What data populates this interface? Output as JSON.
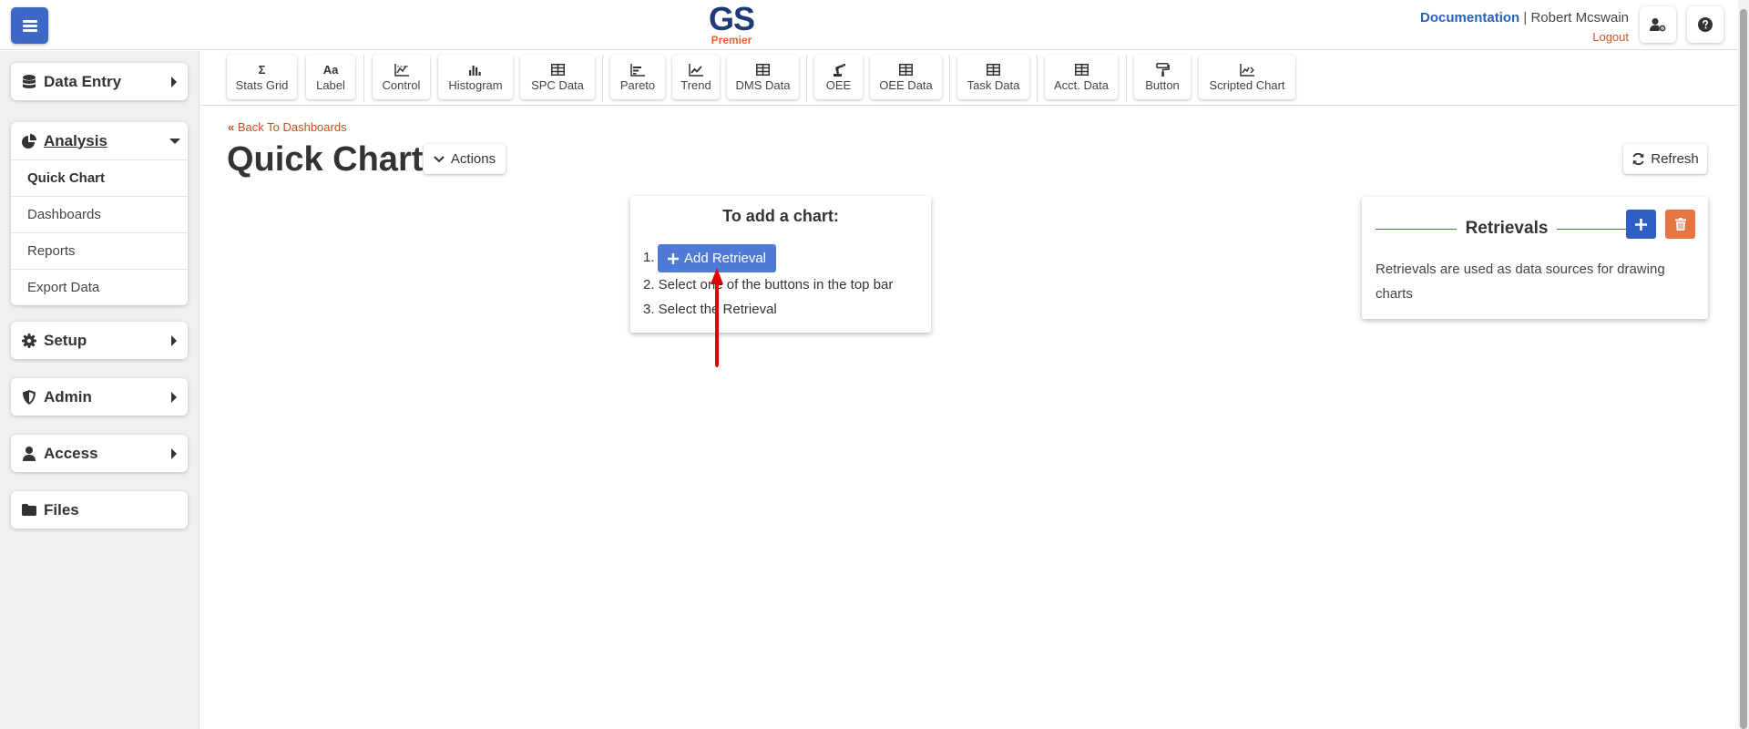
{
  "header": {
    "logo_main": "GS",
    "logo_sub": "Premier",
    "documentation": "Documentation",
    "separator": "|",
    "user_name": "Robert Mcswain",
    "logout": "Logout"
  },
  "sidebar": {
    "data_entry": "Data Entry",
    "analysis": "Analysis",
    "analysis_items": [
      "Quick Chart",
      "Dashboards",
      "Reports",
      "Export Data"
    ],
    "setup": "Setup",
    "admin": "Admin",
    "access": "Access",
    "files": "Files"
  },
  "toolbar": {
    "buttons": [
      {
        "icon": "sigma-icon",
        "label": "Stats Grid"
      },
      {
        "icon": "text-aa-icon",
        "label": "Label"
      },
      {
        "icon": "control-chart-icon",
        "label": "Control"
      },
      {
        "icon": "histogram-icon",
        "label": "Histogram"
      },
      {
        "icon": "table-icon",
        "label": "SPC Data"
      },
      {
        "icon": "pareto-icon",
        "label": "Pareto"
      },
      {
        "icon": "trend-icon",
        "label": "Trend"
      },
      {
        "icon": "table-icon",
        "label": "DMS Data"
      },
      {
        "icon": "robot-arm-icon",
        "label": "OEE"
      },
      {
        "icon": "table-icon",
        "label": "OEE Data"
      },
      {
        "icon": "table-icon",
        "label": "Task Data"
      },
      {
        "icon": "table-icon",
        "label": "Acct. Data"
      },
      {
        "icon": "paint-roller-icon",
        "label": "Button"
      },
      {
        "icon": "scripted-chart-icon",
        "label": "Scripted Chart"
      }
    ]
  },
  "main": {
    "back_link": "Back To Dashboards",
    "title": "Quick Chart",
    "actions_label": "Actions",
    "refresh_label": "Refresh"
  },
  "help": {
    "title": "To add a chart:",
    "step1_num": "1.",
    "add_retrieval": "Add Retrieval",
    "step2": "2. Select one of the buttons in the top bar",
    "step3": "3. Select the Retrieval"
  },
  "retrievals": {
    "title": "Retrievals",
    "description": "Retrievals are used as data sources for drawing charts"
  },
  "colors": {
    "primary": "#3d68c7",
    "accent": "#e0632a",
    "danger": "#e57642",
    "arrow": "#e00000"
  }
}
